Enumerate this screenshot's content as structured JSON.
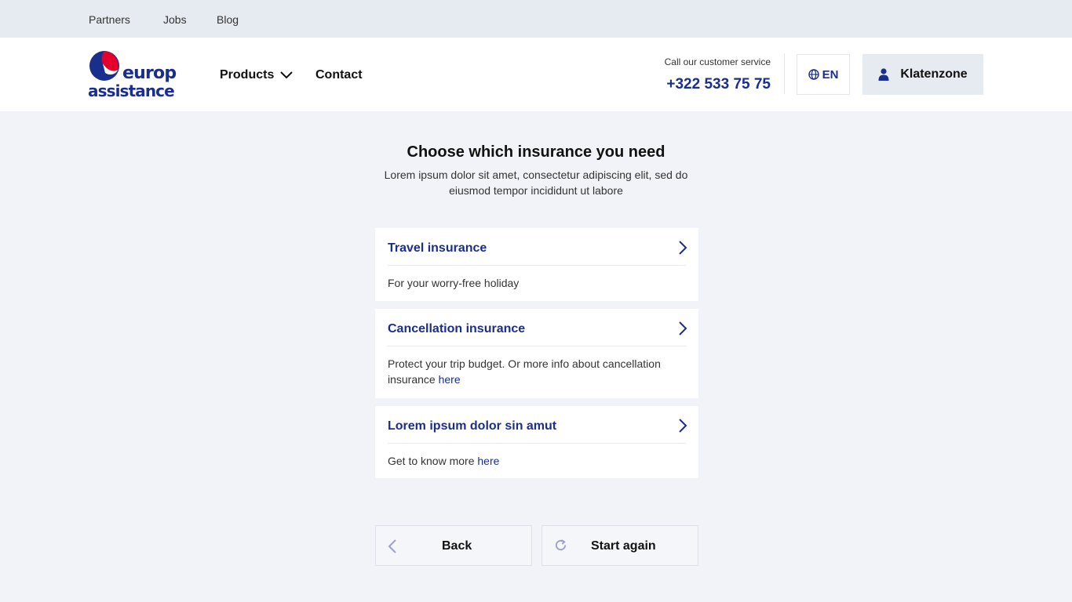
{
  "topbar": {
    "links": [
      "Partners",
      "Jobs",
      "Blog"
    ]
  },
  "header": {
    "logo": {
      "line1": "europ",
      "line2": "assistance"
    },
    "nav": {
      "products": "Products",
      "contact": "Contact"
    },
    "customer_service": {
      "label": "Call our customer service",
      "phone": "+322 533 75 75"
    },
    "language": "EN",
    "account_button": "Klatenzone"
  },
  "main": {
    "title": "Choose which insurance you need",
    "subtitle": "Lorem ipsum dolor sit amet, consectetur adipiscing elit, sed do eiusmod tempor incididunt ut labore",
    "cards": [
      {
        "title": "Travel insurance",
        "desc": "For your worry-free holiday",
        "link": ""
      },
      {
        "title": "Cancellation insurance",
        "desc": "Protect your trip budget. Or more info about cancellation insurance ",
        "link": "here"
      },
      {
        "title": "Lorem ipsum dolor sin amut",
        "desc": "Get to know more ",
        "link": "here"
      }
    ],
    "buttons": {
      "back": "Back",
      "start_again": "Start again"
    }
  },
  "colors": {
    "brand_blue": "#1a2e8c",
    "brand_red": "#e4002b",
    "background": "#f2f3f8"
  },
  "icons": [
    "chevron-down-icon",
    "globe-icon",
    "user-icon",
    "chevron-right-icon",
    "chevron-left-icon",
    "refresh-icon"
  ]
}
